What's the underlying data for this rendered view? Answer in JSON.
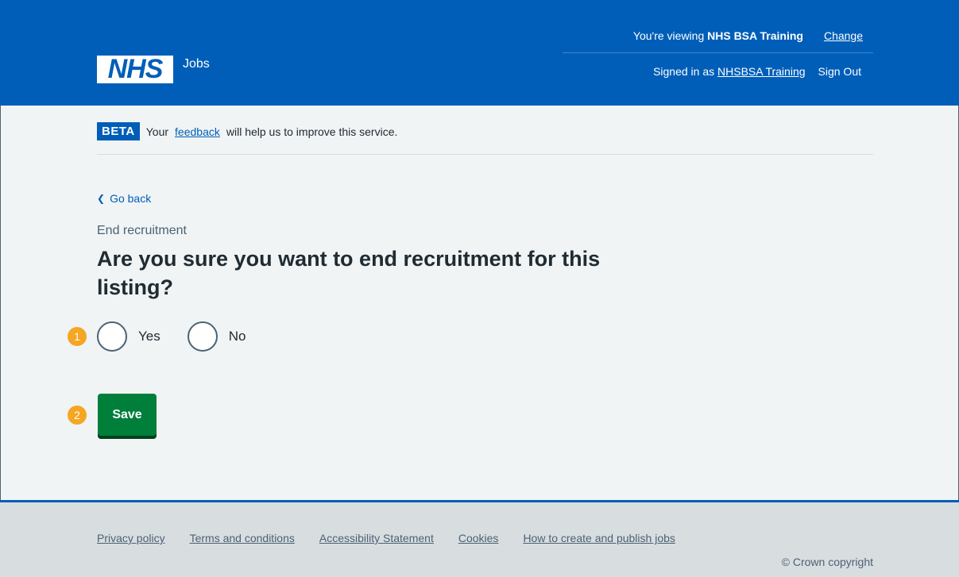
{
  "header": {
    "brand": "NHS",
    "service": "Jobs",
    "viewing_prefix": "You're viewing ",
    "viewing_org": "NHS BSA Training",
    "change_link": "Change",
    "signed_in_prefix": "Signed in as",
    "signed_in_user": "NHSBSA Training",
    "sign_out": "Sign Out"
  },
  "beta": {
    "tag": "BETA",
    "text_before": "Your",
    "feedback_link": "feedback",
    "text_after": "will help us to improve this service."
  },
  "main": {
    "back_link": "Go back",
    "caption": "End recruitment",
    "heading": "Are you sure you want to end recruitment for this listing?",
    "options": [
      {
        "label": "Yes",
        "selected": false
      },
      {
        "label": "No",
        "selected": false
      }
    ],
    "save_button": "Save",
    "step_badges": [
      "1",
      "2"
    ]
  },
  "footer": {
    "links": [
      "Privacy policy",
      "Terms and conditions",
      "Accessibility Statement",
      "Cookies",
      "How to create and publish jobs"
    ],
    "copyright": "© Crown copyright"
  },
  "colors": {
    "nhs_blue": "#005eb8",
    "button_green": "#007f3b",
    "badge_orange": "#f5a623",
    "page_bg": "#f0f4f5",
    "footer_bg": "#d8dde0"
  }
}
